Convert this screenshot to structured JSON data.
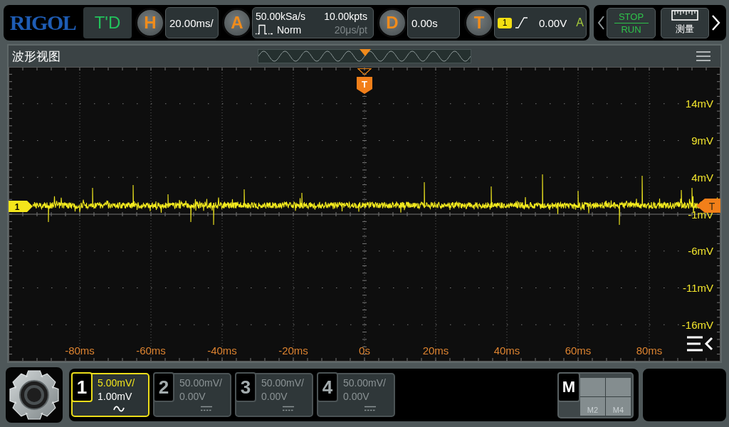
{
  "top_bar": {
    "logo": "RIGOL",
    "mode": "T'D",
    "horizontal": {
      "letter": "H",
      "scale": "20.00ms/"
    },
    "acquire": {
      "letter": "A",
      "sample_rate": "50.00kSa/s",
      "memory_depth": "10.00kpts",
      "mode": "Norm",
      "resolution": "20μs/pt"
    },
    "delay": {
      "letter": "D",
      "value": "0.00s"
    },
    "trigger": {
      "letter": "T",
      "source": "1",
      "rising_slope": true,
      "voltage": "0.00V",
      "sweep": "A"
    },
    "run_button": {
      "top": "STOP",
      "bottom": "RUN"
    },
    "measure_button": {
      "label": "测量"
    }
  },
  "waveform_view": {
    "title": "波形视图",
    "trigger_position_marker": "T",
    "channel_marker": "1",
    "trigger_level_marker": "T",
    "y_labels": [
      "14mV",
      "9mV",
      "4mV",
      "-1mV",
      "-6mV",
      "-11mV",
      "-16mV"
    ],
    "x_labels": [
      "-80ms",
      "-60ms",
      "-40ms",
      "-20ms",
      "0s",
      "20ms",
      "40ms",
      "60ms",
      "80ms"
    ]
  },
  "channels": [
    {
      "number": "1",
      "scale": "5.00mV/",
      "offset": "1.00mV",
      "kind": "ac",
      "on": true
    },
    {
      "number": "2",
      "scale": "50.00mV/",
      "offset": "0.00V",
      "kind": "dc",
      "on": false
    },
    {
      "number": "3",
      "scale": "50.00mV/",
      "offset": "0.00V",
      "kind": "dc",
      "on": false
    },
    {
      "number": "4",
      "scale": "50.00mV/",
      "offset": "0.00V",
      "kind": "dc",
      "on": false
    }
  ],
  "math": {
    "label": "M",
    "cells": [
      "M2",
      "M4"
    ]
  }
}
